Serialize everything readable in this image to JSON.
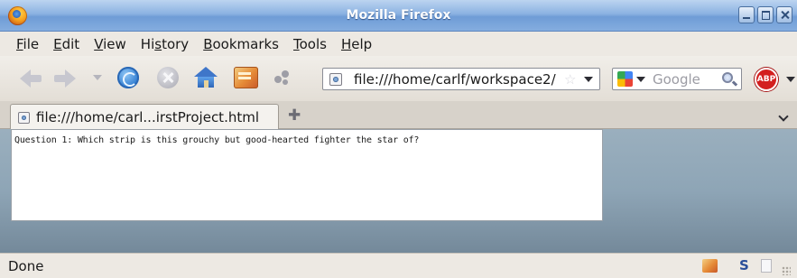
{
  "window": {
    "title": "Mozilla Firefox"
  },
  "menu": {
    "items": [
      {
        "pre": "",
        "ul": "F",
        "post": "ile"
      },
      {
        "pre": "",
        "ul": "E",
        "post": "dit"
      },
      {
        "pre": "",
        "ul": "V",
        "post": "iew"
      },
      {
        "pre": "Hi",
        "ul": "s",
        "post": "tory"
      },
      {
        "pre": "",
        "ul": "B",
        "post": "ookmarks"
      },
      {
        "pre": "",
        "ul": "T",
        "post": "ools"
      },
      {
        "pre": "",
        "ul": "H",
        "post": "elp"
      }
    ]
  },
  "navbar": {
    "url": "file:///home/carlf/workspace2/",
    "search_placeholder": "Google",
    "adblock_label": "ABP"
  },
  "tabs": [
    {
      "label": "file:///home/carl...irstProject.html",
      "active": true
    }
  ],
  "page": {
    "question": "Question 1: Which strip is this grouchy but good-hearted fighter the star of?"
  },
  "status": {
    "text": "Done"
  },
  "icons": {
    "titlebar": "firefox-logo-icon",
    "back": "back-arrow-icon",
    "forward": "forward-arrow-icon",
    "reload": "reload-icon",
    "stop": "stop-icon",
    "home": "home-icon",
    "bookmarks": "bookmarks-book-icon",
    "extension": "gear-icon",
    "adblock": "adblock-plus-icon"
  },
  "colors": {
    "titlebar": "#7aa4da",
    "content_background": "#8ea5b6",
    "adblock": "#d31f1f"
  }
}
